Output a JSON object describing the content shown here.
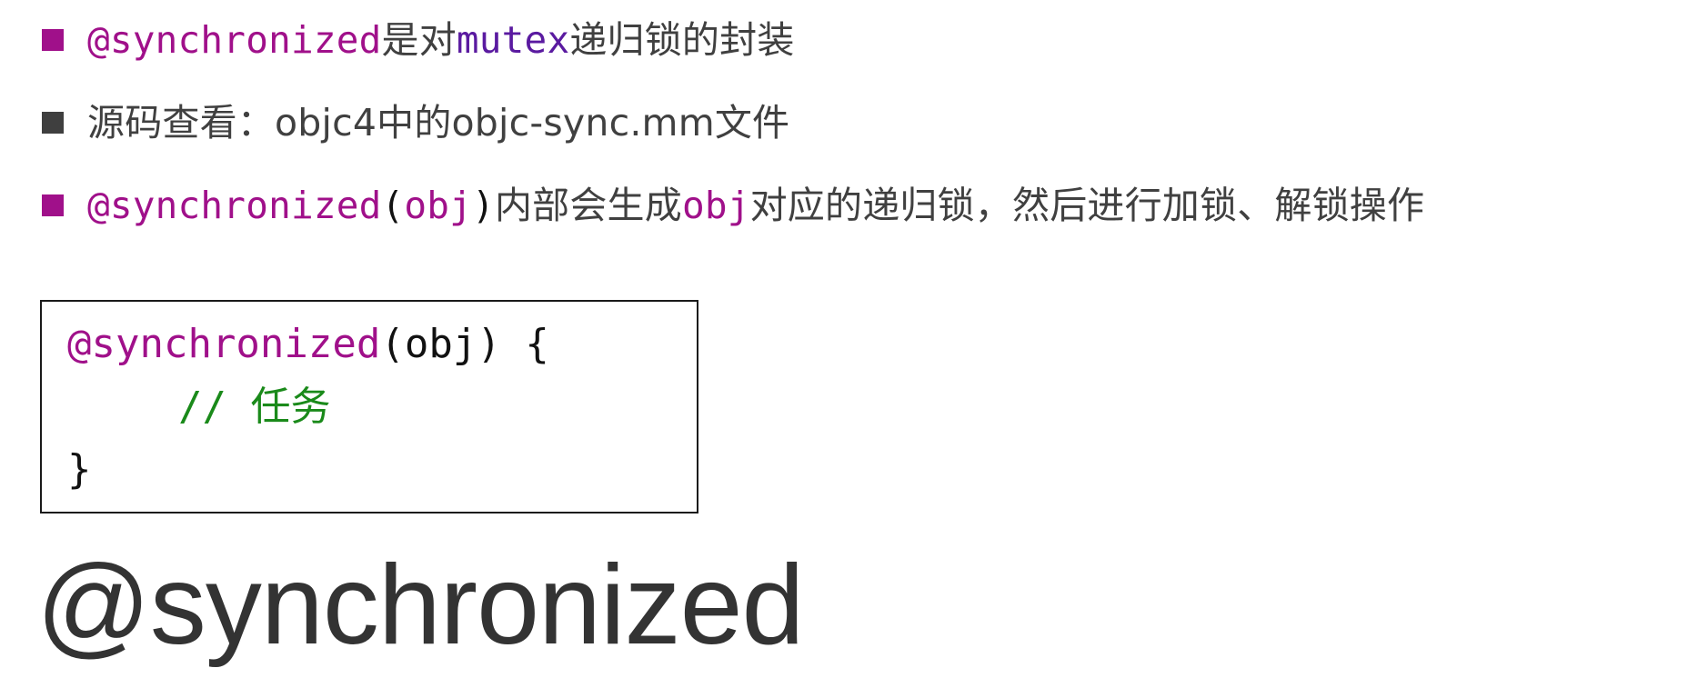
{
  "bullets": [
    {
      "parts": [
        "@synchronized",
        "是对",
        "mutex",
        "递归锁的封装"
      ]
    },
    {
      "text": "源码查看：objc4中的objc-sync.mm文件"
    },
    {
      "parts": [
        "@synchronized",
        "(",
        "obj",
        ")",
        "内部会生成",
        "obj",
        "对应的递归锁，然后进行加锁、解锁操作"
      ]
    }
  ],
  "code": {
    "line1_kw": "@synchronized",
    "line1_rest": "(obj) {",
    "line2": "// 任务",
    "line3": "}"
  },
  "title": "@synchronized",
  "colors": {
    "keyword": "#a0108a",
    "purple": "#5a1aa0",
    "comment": "#1a8a1a",
    "text": "#404040"
  }
}
